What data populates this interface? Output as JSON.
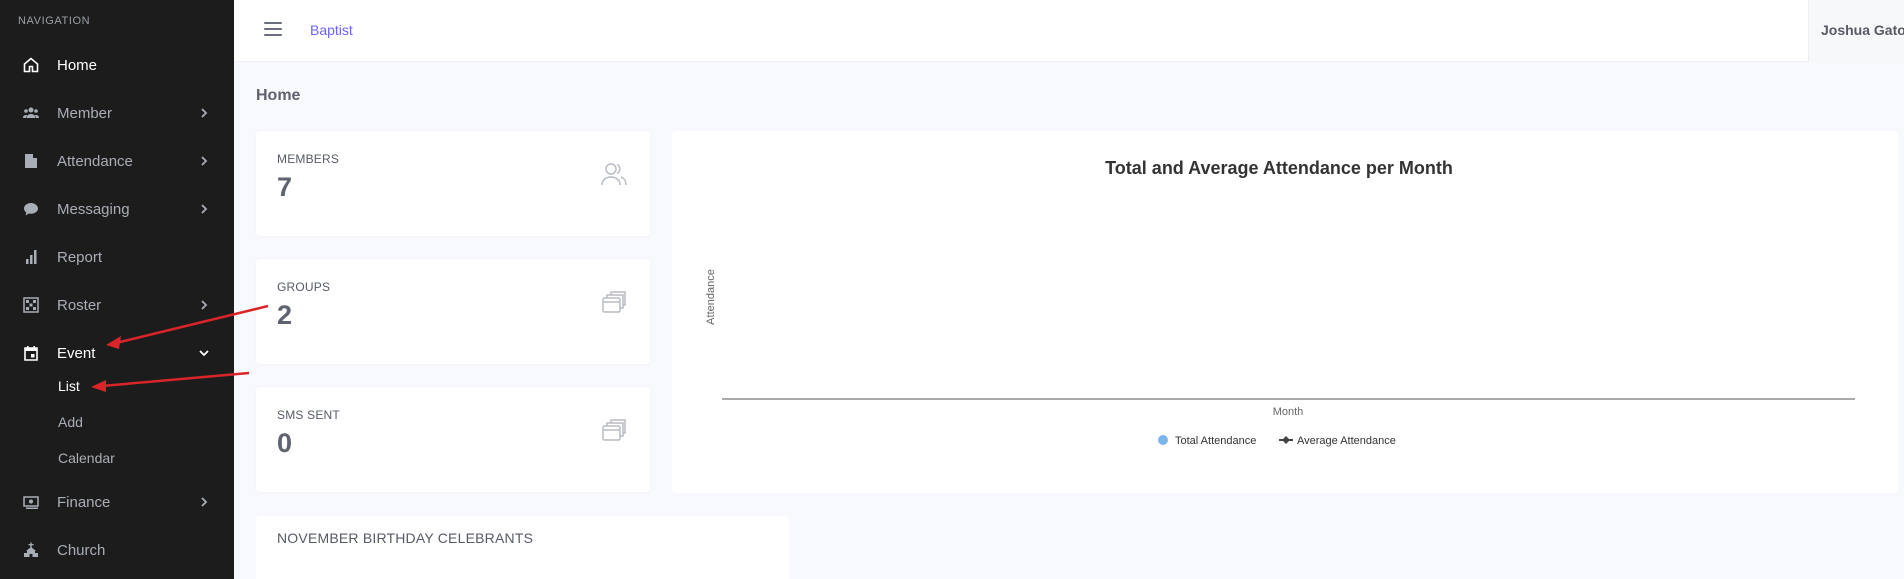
{
  "sidebar": {
    "header": "NAVIGATION",
    "items": [
      {
        "label": "Home",
        "icon": "home-icon"
      },
      {
        "label": "Member",
        "icon": "users-icon"
      },
      {
        "label": "Attendance",
        "icon": "attendance-icon"
      },
      {
        "label": "Messaging",
        "icon": "chat-icon"
      },
      {
        "label": "Report",
        "icon": "bar-chart-icon"
      },
      {
        "label": "Roster",
        "icon": "grid-icon"
      },
      {
        "label": "Event",
        "icon": "calendar-icon"
      },
      {
        "label": "Finance",
        "icon": "money-icon"
      },
      {
        "label": "Church",
        "icon": "church-icon"
      }
    ],
    "event_subitems": [
      "List",
      "Add",
      "Calendar"
    ]
  },
  "header": {
    "brand": "Baptist",
    "user_name": "Joshua Gato"
  },
  "main": {
    "page_title": "Home",
    "stats": [
      {
        "title": "MEMBERS",
        "value": "7",
        "icon": "users-outline-icon"
      },
      {
        "title": "GROUPS",
        "value": "2",
        "icon": "stack-icon"
      },
      {
        "title": "SMS SENT",
        "value": "0",
        "icon": "stack-icon"
      }
    ],
    "birthday_title": "NOVEMBER BIRTHDAY CELEBRANTS"
  },
  "chart_data": {
    "type": "bar",
    "title": "Total and Average Attendance per Month",
    "xlabel": "Month",
    "ylabel": "Attendance",
    "categories": [],
    "series": [
      {
        "name": "Total Attendance",
        "type": "bar",
        "values": [],
        "color": "#7cb5ec"
      },
      {
        "name": "Average Attendance",
        "type": "line",
        "values": [],
        "color": "#434348"
      }
    ],
    "legend": "bottom-center"
  },
  "colors": {
    "sidebar_bg": "#1c1c1c",
    "brand": "#6c63ff",
    "annotation_arrow": "#d9252a"
  }
}
